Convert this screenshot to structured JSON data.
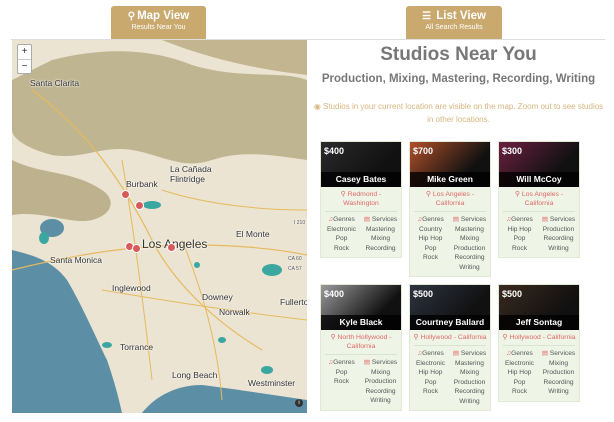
{
  "tabs": {
    "map": {
      "icon": "map-marker-icon",
      "label": "Map View",
      "sub": "Results Near You"
    },
    "list": {
      "icon": "list-icon",
      "label": "List View",
      "sub": "All Search Results"
    }
  },
  "map": {
    "zoom_in": "+",
    "zoom_out": "−",
    "labels": {
      "santa_clarita": "Santa Clarita",
      "la_canada": "La Cañada\nFlintridge",
      "burbank": "Burbank",
      "glendale_hint": "",
      "el_monte": "El Monte",
      "los_angeles": "Los Angeles",
      "santa_monica": "Santa Monica",
      "inglewood": "Inglewood",
      "downey": "Downey",
      "norwalk": "Norwalk",
      "fullerton": "Fullerto",
      "torrance": "Torrance",
      "long_beach": "Long Beach",
      "westminster": "Westminster",
      "ca60": "CA 60",
      "ca57": "CA 57",
      "i210": "I 210"
    },
    "attribution": "i",
    "colors": {
      "land": "#ebe4d2",
      "mountain": "#b9ad86",
      "water": "#5c8fa6",
      "park": "#3aa7a0",
      "pin": "#d95a5a"
    }
  },
  "header": {
    "title": "Studios Near You",
    "subtitle": "Production, Mixing, Mastering, Recording, Writing",
    "note_icon": "eye-icon",
    "note": "Studios in your current location are visible on the map. Zoom out to see studios in other locations."
  },
  "studios": [
    {
      "price": "$400",
      "name": "Casey Bates",
      "location": "Redmond - Washington",
      "genres_label": "Genres",
      "genres": [
        "Electronic",
        "Pop",
        "Rock"
      ],
      "services_label": "Services",
      "services": [
        "Mastering",
        "Mixing",
        "Recording"
      ],
      "img_color": "#2a2a2a"
    },
    {
      "price": "$700",
      "name": "Mike Green",
      "location": "Los Angeles - California",
      "genres_label": "Genres",
      "genres": [
        "Country",
        "Hip Hop",
        "Pop",
        "Rock"
      ],
      "services_label": "Services",
      "services": [
        "Mastering",
        "Mixing",
        "Production",
        "Recording",
        "Writing"
      ],
      "img_color": "#b0502a"
    },
    {
      "price": "$300",
      "name": "Will McCoy",
      "location": "Los Angeles - California",
      "genres_label": "Genres",
      "genres": [
        "Hip Hop",
        "Pop",
        "Rock"
      ],
      "services_label": "Services",
      "services": [
        "Production",
        "Recording",
        "Writing"
      ],
      "img_color": "#6b2040"
    },
    {
      "price": "$400",
      "name": "Kyle Black",
      "location": "North Hollywood - California",
      "genres_label": "Genres",
      "genres": [
        "Pop",
        "Rock"
      ],
      "services_label": "Services",
      "services": [
        "Mixing",
        "Production",
        "Recording",
        "Writing"
      ],
      "img_color": "#9a9a9a"
    },
    {
      "price": "$500",
      "name": "Courtney Ballard",
      "location": "Hollywood - California",
      "genres_label": "Genres",
      "genres": [
        "Electronic",
        "Hip Hop",
        "Pop",
        "Rock"
      ],
      "services_label": "Services",
      "services": [
        "Mastering",
        "Mixing",
        "Production",
        "Recording",
        "Writing"
      ],
      "img_color": "#2d3340"
    },
    {
      "price": "$500",
      "name": "Jeff Sontag",
      "location": "Hollywood - California",
      "genres_label": "Genres",
      "genres": [
        "Electronic",
        "Hip Hop",
        "Pop",
        "Rock"
      ],
      "services_label": "Services",
      "services": [
        "Mixing",
        "Production",
        "Recording",
        "Writing"
      ],
      "img_color": "#3a2a1f"
    }
  ]
}
